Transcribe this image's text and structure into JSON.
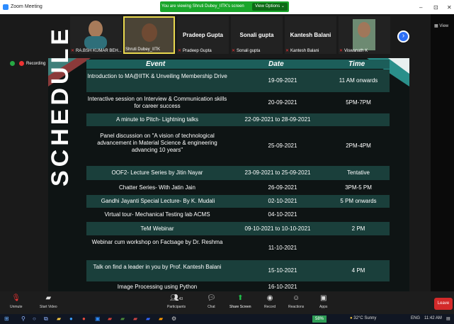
{
  "window": {
    "title": "Zoom Meeting",
    "min": "–",
    "max": "⊡",
    "close": "✕"
  },
  "viewing": {
    "message": "You are viewing Shruti Dubey_IITK's screen",
    "options": "View Options ⌄"
  },
  "sidebar": {
    "view": "View"
  },
  "participants": [
    {
      "name": "RA.BSH KUMAR BEH..."
    },
    {
      "name": "Shruti Dubey_IITK"
    },
    {
      "name": "Pradeep Gupta",
      "big": "Pradeep Gupta"
    },
    {
      "name": "Sonali gupta",
      "big": "Sonali gupta"
    },
    {
      "name": "Kantesh Balani",
      "big": "Kantesh Balani"
    },
    {
      "name": "Viswanath K"
    }
  ],
  "recording": {
    "label": "Recording"
  },
  "slide": {
    "side_title": "SCHEDULE",
    "headers": {
      "event": "Event",
      "date": "Date",
      "time": "Time"
    },
    "rows": [
      {
        "event": "Introduction to MA@IITK & Unveiling Membership Drive",
        "date": "19-09-2021",
        "time": "11 AM onwards"
      },
      {
        "event": "Interactive session on Interview & Communication skills for career success",
        "date": "20-09-2021",
        "time": "5PM-7PM"
      },
      {
        "event": "A minute to Pitch- Lightning talks",
        "date": "22-09-2021 to 28-09-2021",
        "time": ""
      },
      {
        "event": "Panel discussion on \"A vision of technological advancement in Material Science & engineering advancing 10 years\"",
        "date": "25-09-2021",
        "time": "2PM-4PM"
      },
      {
        "event": "OOF2- Lecture Series by Jitin Nayar",
        "date": "23-09-2021 to 25-09-2021",
        "time": "Tentative"
      },
      {
        "event": "Chatter Series- With Jatin Jain",
        "date": "26-09-2021",
        "time": "3PM-5 PM"
      },
      {
        "event": "Gandhi Jayanti Special Lecture- By K. Mudali",
        "date": "02-10-2021",
        "time": "5 PM onwards"
      },
      {
        "event": "Virtual tour- Mechanical Testing lab ACMS",
        "date": "04-10-2021",
        "time": ""
      },
      {
        "event": "TeM Webinar",
        "date": "09-10-2021 to 10-10-2021",
        "time": "2 PM"
      },
      {
        "event": "Webinar cum workshop on Factsage by Dr. Reshma",
        "date": "11-10-2021",
        "time": ""
      },
      {
        "event": "Talk on find a leader in you by Prof. Kantesh Balani",
        "date": "15-10-2021",
        "time": "4 PM"
      },
      {
        "event": "Image Processing using Python",
        "date": "16-10-2021",
        "time": ""
      }
    ]
  },
  "toolbar": {
    "unmute": "Unmute",
    "start_video": "Start Video",
    "participants": "Participants",
    "participants_count": "43",
    "chat": "Chat",
    "share_screen": "Share Screen",
    "record": "Record",
    "reactions": "Reactions",
    "apps": "Apps",
    "leave": "Leave"
  },
  "taskbar": {
    "battery": "58%",
    "weather": "32°C Sunny",
    "lang": "ENG",
    "clock": "11:42 AM"
  }
}
